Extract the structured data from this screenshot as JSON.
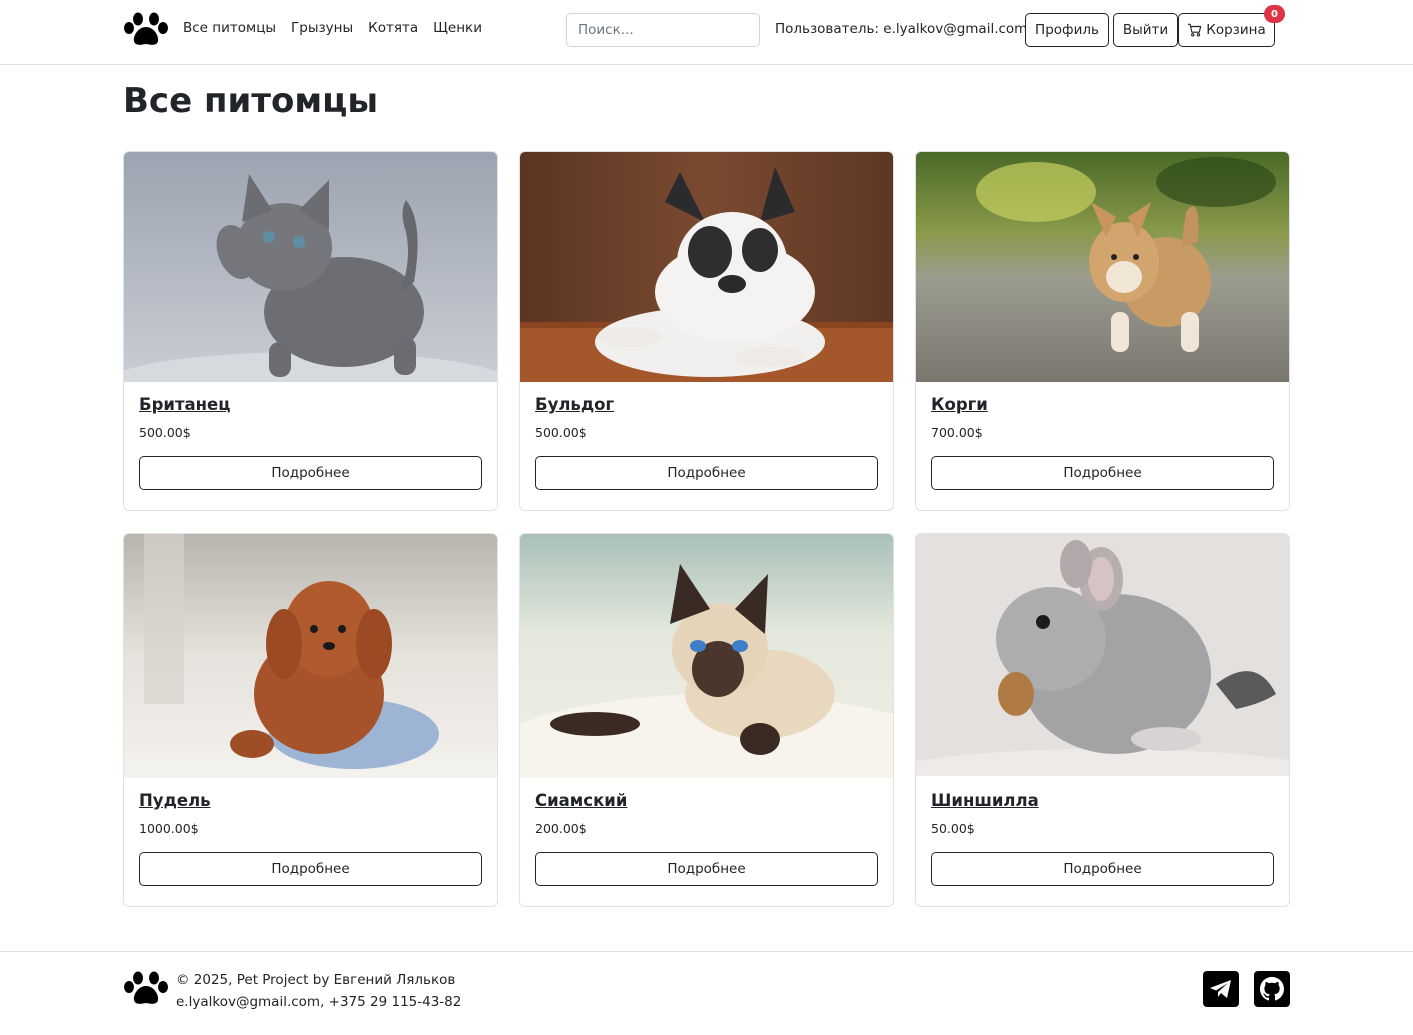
{
  "header": {
    "logo_icon": "paw-icon",
    "nav": [
      "Все питомцы",
      "Грызуны",
      "Котята",
      "Щенки"
    ],
    "search_placeholder": "Поиск...",
    "user_text": "Пользователь: e.lyalkov@gmail.com",
    "profile_label": "Профиль",
    "logout_label": "Выйти",
    "cart_label": "Корзина",
    "cart_icon": "cart-icon",
    "cart_count": "0"
  },
  "main": {
    "title": "Все питомцы",
    "cards": [
      {
        "name": "Британец",
        "price": "500.00$",
        "button": "Подробнее",
        "image": "gray-kitten-photo"
      },
      {
        "name": "Бульдог",
        "price": "500.00$",
        "button": "Подробнее",
        "image": "french-bulldog-photo"
      },
      {
        "name": "Корги",
        "price": "700.00$",
        "button": "Подробнее",
        "image": "corgi-puppy-photo"
      },
      {
        "name": "Пудель",
        "price": "1000.00$",
        "button": "Подробнее",
        "image": "poodle-puppy-photo"
      },
      {
        "name": "Сиамский",
        "price": "200.00$",
        "button": "Подробнее",
        "image": "siamese-kitten-photo"
      },
      {
        "name": "Шиншилла",
        "price": "50.00$",
        "button": "Подробнее",
        "image": "chinchilla-photo"
      }
    ]
  },
  "footer": {
    "copyright": "© 2025, Pet Project by Евгений Ляльков",
    "contact": "e.lyalkov@gmail.com, +375 29 115-43-82",
    "telegram_icon": "telegram-icon",
    "github_icon": "github-icon"
  },
  "colors": {
    "text": "#212529",
    "border": "#dee2e6",
    "badge": "#dc3545"
  }
}
